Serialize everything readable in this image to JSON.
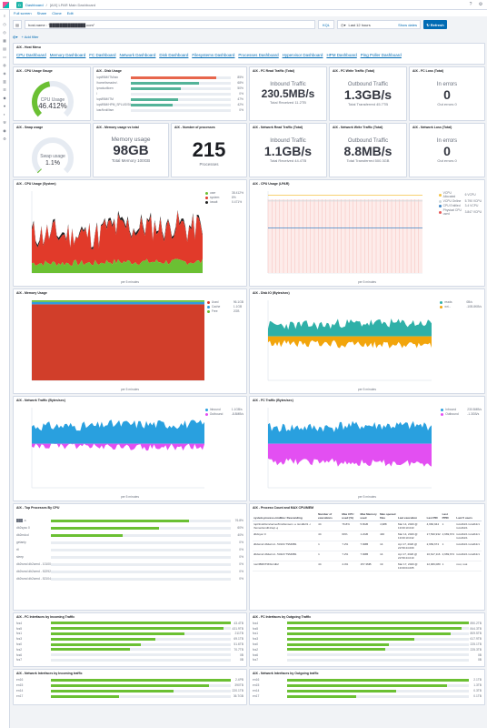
{
  "header": {
    "space_letter": "D",
    "breadcrumb_root": "Dashboard",
    "breadcrumb_sep": "/",
    "title": "[AIX] LPAR Main Dashboard"
  },
  "toolbar": {
    "fullscreen": "Full screen",
    "share": "Share",
    "clone": "Clone",
    "edit": "Edit"
  },
  "query": {
    "value": "host.name : \"██████████████.com\"",
    "language": "KQL",
    "time": "Last 12 hours",
    "show_dates": "Show dates",
    "refresh": "Refresh"
  },
  "filters": {
    "add": "+ Add filter"
  },
  "panels": {
    "host_menu": {
      "title": "AIX - Host Menu",
      "links": [
        "CPU Dashboard",
        "Memory Dashboard",
        "FC Dashboard",
        "Network Dashboard",
        "Disk Dashboard",
        "Filesystems Dashboard",
        "Processes Dashboard",
        "Hypervisor Dashboard",
        "HPM Dashboard",
        "Ping Poller Dashboard"
      ]
    },
    "cpu_gauge": {
      "title": "AIX - CPU Usage Gauge",
      "label": "CPU Usage",
      "value": "46.412%",
      "fraction": 0.464
    },
    "disk_usage": {
      "title": "AIX - Disk Usage",
      "rows": [
        {
          "label": "/opt/IBM/ITM/aix",
          "value": "85%",
          "pct": 85,
          "color": "#e7664c"
        },
        {
          "label": "/home/tsmadm/.",
          "value": "68%",
          "pct": 68,
          "color": "#54b399"
        },
        {
          "label": "/productlicen",
          "value": "50%",
          "pct": 50,
          "color": "#54b399"
        },
        {
          "label": "/",
          "value": "0%",
          "pct": 0,
          "color": "#54b399"
        },
        {
          "label": "/opt/IBM/ITM",
          "value": "47%",
          "pct": 47,
          "color": "#54b399"
        },
        {
          "label": "/opt/IBM/HPM_SPLUS/S07",
          "value": "42%",
          "pct": 42,
          "color": "#54b399"
        },
        {
          "label": "/usr/tivoli/tsm",
          "value": "0%",
          "pct": 0,
          "color": "#54b399"
        }
      ]
    },
    "fc_read": {
      "title": "AIX - FC Read Traffic (Total)",
      "caption": "Inbound Traffic",
      "value": "230.5MB/s",
      "sub": "Total Received 11.2TB"
    },
    "fc_write": {
      "title": "AIX - FC Write Traffic (Total)",
      "caption": "Outbound Traffic",
      "value": "1.3GB/s",
      "sub": "Total Transferred 45.7TB"
    },
    "fc_loss": {
      "title": "AIX - FC Loss (Total)",
      "caption": "In errors",
      "value": "0",
      "sub": "Out errors 0"
    },
    "swap": {
      "title": "AIX - Swap usage",
      "label": "Swap usage",
      "value": "1.1%",
      "fraction": 0.011
    },
    "memory": {
      "title": "AIX - Memory usage vs total",
      "caption": "Memory usage",
      "value": "98GB",
      "sub": "Total Memory 100GB"
    },
    "processes": {
      "title": "AIX - Number of processes",
      "value": "215",
      "sub": "Processes"
    },
    "net_read": {
      "title": "AIX - Network Read Traffic (Total)",
      "caption": "Inbound Traffic",
      "value": "1.1GB/s",
      "sub": "Total Received 44.4TB"
    },
    "net_write": {
      "title": "AIX - Network Write Traffic (Total)",
      "caption": "Outbound Traffic",
      "value": "8.8MB/s",
      "sub": "Total Transferred 500.3GB"
    },
    "net_loss": {
      "title": "AIX - Network Loss (Total)",
      "caption": "In errors",
      "value": "0",
      "sub": "Out errors 0"
    },
    "cpu_system": {
      "title": "AIX - CPU Usage (System)",
      "legend": [
        {
          "name": "user",
          "value": "38.412%",
          "color": "#6bc033"
        },
        {
          "name": "system",
          "value": "8%",
          "color": "#e13a2a"
        },
        {
          "name": "iowait",
          "value": "0.471%",
          "color": "#222222"
        }
      ],
      "xlabel": "per 5 minutes"
    },
    "cpu_lpar": {
      "title": "AIX - CPU Usage (LPAR)",
      "legend": [
        {
          "name": "VCPU Allocated",
          "value": "6 VCPU",
          "color": "#f5c343"
        },
        {
          "name": "VCPU Online",
          "value": "5.790 VCPU",
          "color": "#cfd8dc"
        },
        {
          "name": "CPU Entitled",
          "value": "3.4 VCPU",
          "color": "#3d85c6"
        },
        {
          "name": "Physical CPU used",
          "value": "3.847 VCPU",
          "color": "#e65a5a"
        }
      ],
      "xlabel": "per 5 minutes"
    },
    "memory_usage": {
      "title": "AIX - Memory Usage",
      "legend": [
        {
          "name": "Used",
          "value": "96.1GB",
          "color": "#d13e2a"
        },
        {
          "name": "Cache",
          "value": "1.1GB",
          "color": "#2f9cde"
        },
        {
          "name": "Free",
          "value": "2GB",
          "color": "#6bc033"
        }
      ],
      "xlabel": "per 5 minutes"
    },
    "disk_io": {
      "title": "AIX - Disk IO (Bytes/sec)",
      "legend": [
        {
          "name": "reads",
          "value": "0B/s",
          "color": "#2fb0a8"
        },
        {
          "name": "wri...",
          "value": "-10B.8KB/s",
          "color": "#f2a50c"
        }
      ],
      "xlabel": "per 5 minutes"
    },
    "net_traffic": {
      "title": "AIX - Network Traffic (Bytes/sec)",
      "legend": [
        {
          "name": "Inbound",
          "value": "1.1GB/s",
          "color": "#29a0df"
        },
        {
          "name": "Outbound",
          "value": "-8.8MB/s",
          "color": "#e34ff2"
        }
      ],
      "xlabel": "per 5 minutes"
    },
    "fc_traffic": {
      "title": "AIX - FC Traffic (Bytes/sec)",
      "legend": [
        {
          "name": "Inbound",
          "value": "230.5MB/s",
          "color": "#29a0df"
        },
        {
          "name": "Outbound",
          "value": "-1.3GB/s",
          "color": "#e34ff2"
        }
      ],
      "xlabel": "per 5 minutes"
    },
    "top_proc": {
      "title": "AIX - Top Processes By CPU",
      "rows": [
        {
          "label": "███ -s",
          "value": "76.8%",
          "pct": 76.8
        },
        {
          "label": "db2sysc 0",
          "value": "60%",
          "pct": 60
        },
        {
          "label": "db2mdcd",
          "value": "40%",
          "pct": 40
        },
        {
          "label": "getanty",
          "value": "0%",
          "pct": 0
        },
        {
          "label": "rtl",
          "value": "0%",
          "pct": 0
        },
        {
          "label": "sleep",
          "value": "0%",
          "pct": 0
        },
        {
          "label": "db2wmd db2wmd - 101002 TSMDB1",
          "value": "0%",
          "pct": 0
        },
        {
          "label": "db2wmd db2wmd - 522922 TSMDB1",
          "value": "0%",
          "pct": 0
        },
        {
          "label": "db2wmd db2wmd - 52104 TSMDB1",
          "value": "0%",
          "pct": 0
        }
      ]
    },
    "proc_count": {
      "title": "AIX - Process Count and MAX CPU/MEM",
      "headers": [
        "system.process.cmdline: Descending",
        "Number of executions",
        "Max CPU used (%)",
        "Max Memory used",
        "Max opened files",
        "Last execution",
        "Last PID",
        "Last PPID",
        "Last 5 users"
      ],
      "rows": [
        [
          "/opt/tivoli/tsm/server/bin/dsmserv -u tsmdb2/1 -i /home/tsmdb1/sql -q",
          "44",
          "76.8%",
          "5.8GB",
          "4,988",
          "Mar 14, 2020 @ 19:00:10.043",
          "4,960,944",
          "1",
          "tsmdb1/1 tsmdb1/1 tsmdb1/1"
        ],
        [
          "db2sysc 0",
          "44",
          "60%",
          "1.2GB",
          "446",
          "Mar 14, 2020 @ 19:00:10.042",
          "17,530,932",
          "2,969,674",
          "tsmdb1/1 tsmdb1/1 tsmdb1/1"
        ],
        [
          "db2wmd db2wmd - 53104 TSMDB1",
          "1",
          "7.2%",
          "7.9MB",
          "14",
          "Apr 17, 2020 @ 22:59:44.009",
          "2,969,674",
          "1",
          "tsmdb1/1 tsmdb1/1"
        ],
        [
          "db2wmd db2wmd - 53423 TSMDB1",
          "1",
          "7.2%",
          "7.9MB",
          "14",
          "Apr 17, 2020 @ 22:59:44.010",
          "10,617,116",
          "2,969,674",
          "tsmdb1/1 tsmdb1/1"
        ],
        [
          "/usr/IBM/ITM/bin/db2",
          "44",
          "4.4%",
          "157.3MB",
          "19",
          "Mar 17, 2020 @ 19:00:04.005",
          "12,006,080",
          "1",
          "root, root"
        ]
      ]
    },
    "fc_in": {
      "title": "AIX - FC Interfaces by Incoming Traffic",
      "rows": [
        {
          "label": "fcs4",
          "value": "43.4TB",
          "pct": 100
        },
        {
          "label": "fcs5",
          "value": "431.9TB",
          "pct": 96
        },
        {
          "label": "fcs1",
          "value": "211TB",
          "pct": 74
        },
        {
          "label": "fcs3",
          "value": "69.1TB",
          "pct": 58
        },
        {
          "label": "fcs0",
          "value": "51.6TB",
          "pct": 50
        },
        {
          "label": "fcs2",
          "value": "70.7TB",
          "pct": 44
        },
        {
          "label": "fcs6",
          "value": "0B",
          "pct": 0
        },
        {
          "label": "fcs7",
          "value": "0B",
          "pct": 0
        }
      ]
    },
    "fc_out": {
      "title": "AIX - FC Interfaces by Outgoing Traffic",
      "rows": [
        {
          "label": "fcs4",
          "value": "890.2TB",
          "pct": 100
        },
        {
          "label": "fcs5",
          "value": "844.3TB",
          "pct": 96
        },
        {
          "label": "fcs1",
          "value": "809.5TB",
          "pct": 90
        },
        {
          "label": "fcs3",
          "value": "617.9TB",
          "pct": 70
        },
        {
          "label": "fcs0",
          "value": "225.1TB",
          "pct": 56
        },
        {
          "label": "fcs2",
          "value": "225.3TB",
          "pct": 54
        },
        {
          "label": "fcs6",
          "value": "0B",
          "pct": 0
        },
        {
          "label": "fcs7",
          "value": "0B",
          "pct": 0
        }
      ]
    },
    "net_in": {
      "title": "AIX - Network Interfaces by Incoming traffic",
      "rows": [
        {
          "label": "en16",
          "value": "2.4PB",
          "pct": 100
        },
        {
          "label": "en15",
          "value": "390TB",
          "pct": 88
        },
        {
          "label": "en14",
          "value": "220.1TB",
          "pct": 68
        },
        {
          "label": "en17",
          "value": "36.7GB",
          "pct": 38
        }
      ]
    },
    "net_out": {
      "title": "AIX - Network Interfaces by Outgoing traffic",
      "rows": [
        {
          "label": "en16",
          "value": "2.1TB",
          "pct": 100
        },
        {
          "label": "en15",
          "value": "1.3TB",
          "pct": 88
        },
        {
          "label": "en14",
          "value": "0.3TB",
          "pct": 60
        },
        {
          "label": "en17",
          "value": "0.1TB",
          "pct": 38
        }
      ]
    }
  },
  "icons": {
    "logo": "kibana-logo",
    "help": "help-icon",
    "settings": "settings-icon",
    "nav": [
      "menu-icon",
      "recent-icon",
      "discover-icon",
      "visualize-icon",
      "dashboard-icon",
      "canvas-icon",
      "maps-icon",
      "ml-icon",
      "metrics-icon",
      "logs-icon",
      "apm-icon",
      "uptime-icon",
      "siem-icon",
      "dev-tools-icon",
      "stack-monitoring-icon",
      "management-icon"
    ]
  }
}
